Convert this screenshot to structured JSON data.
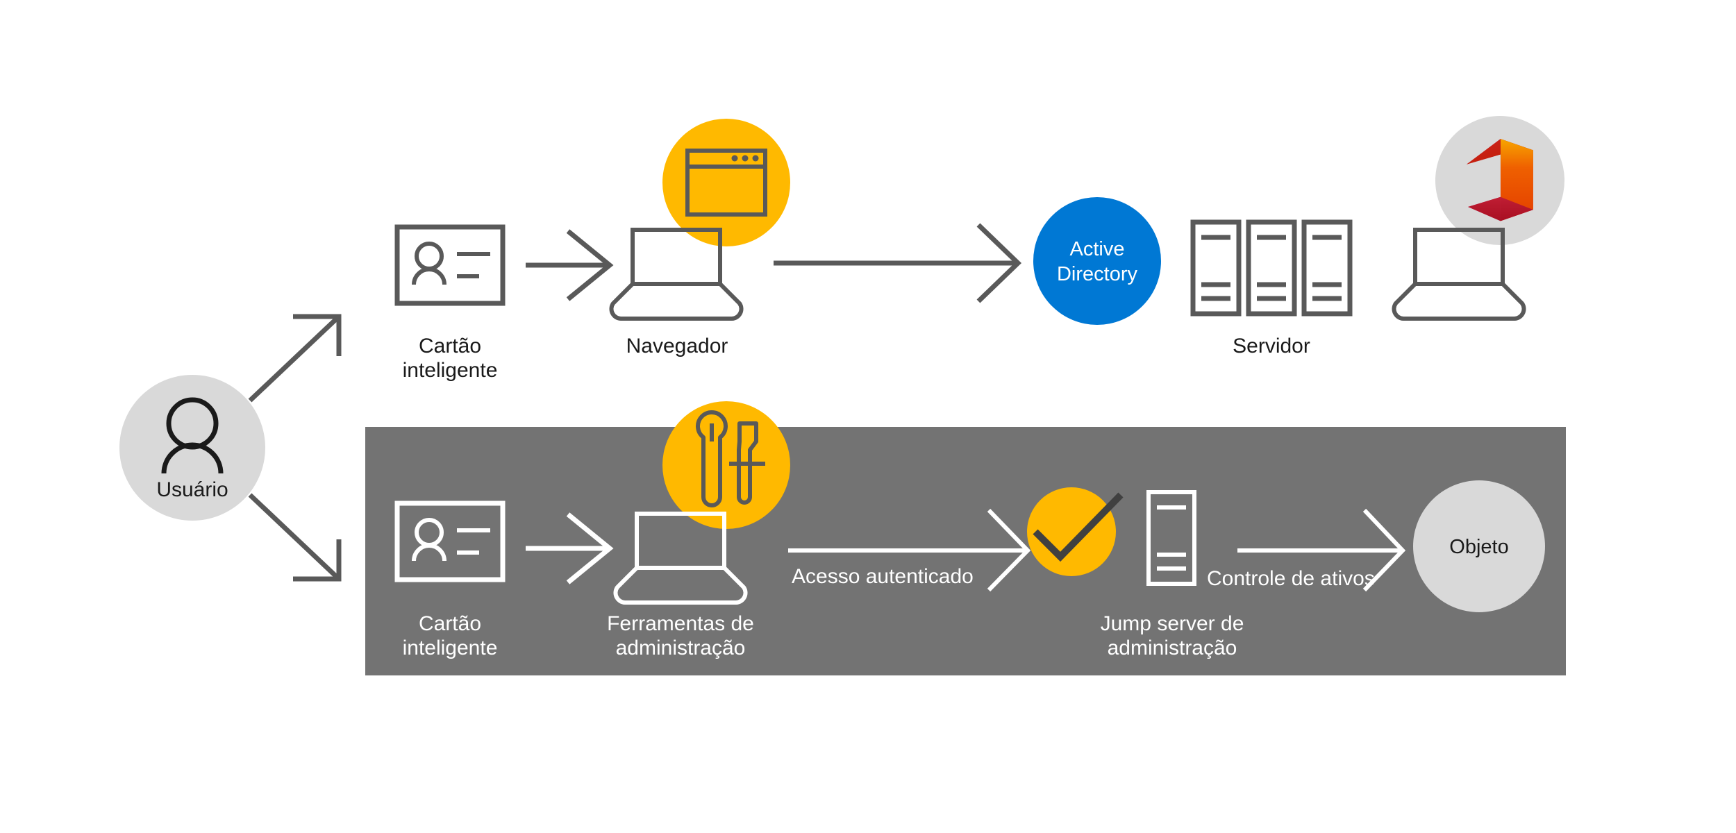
{
  "diagram": {
    "colors": {
      "background": "#ffffff",
      "stroke_dark": "#595959",
      "stroke_darker": "#404040",
      "panel_gray": "#737373",
      "circle_light_gray": "#d9d9d9",
      "accent_orange": "#ffb900",
      "accent_blue": "#0078d4",
      "text_dark": "#1a1a1a",
      "text_light": "#ffffff",
      "office_red": "#c5200d",
      "office_orange": "#eb3c00",
      "office_magenta": "#d32b7d"
    },
    "actor": {
      "label": "Usuário",
      "icon": "person-icon"
    },
    "top_row": {
      "nodes": [
        {
          "id": "smart-card",
          "label_line1": "Cartão",
          "label_line2": "inteligente",
          "icon": "smart-card-icon"
        },
        {
          "id": "browser",
          "label_line1": "Navegador",
          "label_line2": "",
          "icon": "laptop-icon",
          "badge_icon": "browser-window-icon"
        },
        {
          "id": "active-directory",
          "label_line1": "Active",
          "label_line2": "Directory",
          "icon": "blue-circle"
        },
        {
          "id": "server",
          "label_line1": "Servidor",
          "label_line2": "",
          "icon": "server-rack-icon"
        },
        {
          "id": "office",
          "label_line1": "",
          "label_line2": "",
          "icon": "laptop-icon",
          "badge_icon": "office-365-icon"
        }
      ]
    },
    "admin_panel": {
      "nodes": [
        {
          "id": "admin-smart-card",
          "label_line1": "Cartão",
          "label_line2": "inteligente",
          "icon": "smart-card-icon"
        },
        {
          "id": "admin-tools",
          "label_line1": "Ferramentas de",
          "label_line2": "administração",
          "icon": "laptop-icon",
          "badge_icon": "tools-icon"
        },
        {
          "id": "jump-server",
          "label_line1": "Jump server de",
          "label_line2": "administração",
          "icon": "server-rack-icon",
          "badge_icon": "checkmark-icon"
        },
        {
          "id": "object",
          "label_line1": "Objeto",
          "label_line2": "",
          "icon": "gray-circle"
        }
      ],
      "edge_labels": [
        {
          "id": "authenticated-access",
          "text": "Acesso autenticado"
        },
        {
          "id": "asset-control",
          "text": "Controle de ativos"
        }
      ]
    }
  }
}
